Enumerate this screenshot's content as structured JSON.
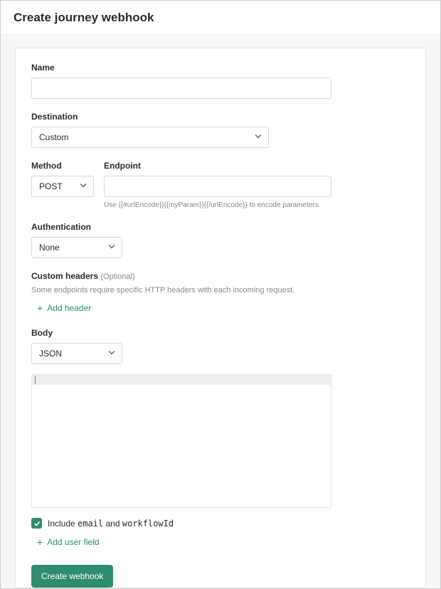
{
  "header": {
    "title": "Create journey webhook"
  },
  "form": {
    "name": {
      "label": "Name",
      "value": ""
    },
    "destination": {
      "label": "Destination",
      "value": "Custom"
    },
    "method": {
      "label": "Method",
      "value": "POST"
    },
    "endpoint": {
      "label": "Endpoint",
      "value": "",
      "helper": "Use {{#urlEncode}}{{myParam}}{{/urlEncode}} to encode parameters"
    },
    "authentication": {
      "label": "Authentication",
      "value": "None"
    },
    "custom_headers": {
      "label": "Custom headers",
      "optional": "(Optional)",
      "description": "Some endpoints require specific HTTP headers with each incoming request.",
      "add_label": "Add header"
    },
    "body": {
      "label": "Body",
      "value": "JSON"
    },
    "include": {
      "checked": true,
      "prefix": "Include ",
      "code1": "email",
      "mid": " and ",
      "code2": "workflowId"
    },
    "add_user_field": "Add user field",
    "submit": "Create webhook"
  }
}
